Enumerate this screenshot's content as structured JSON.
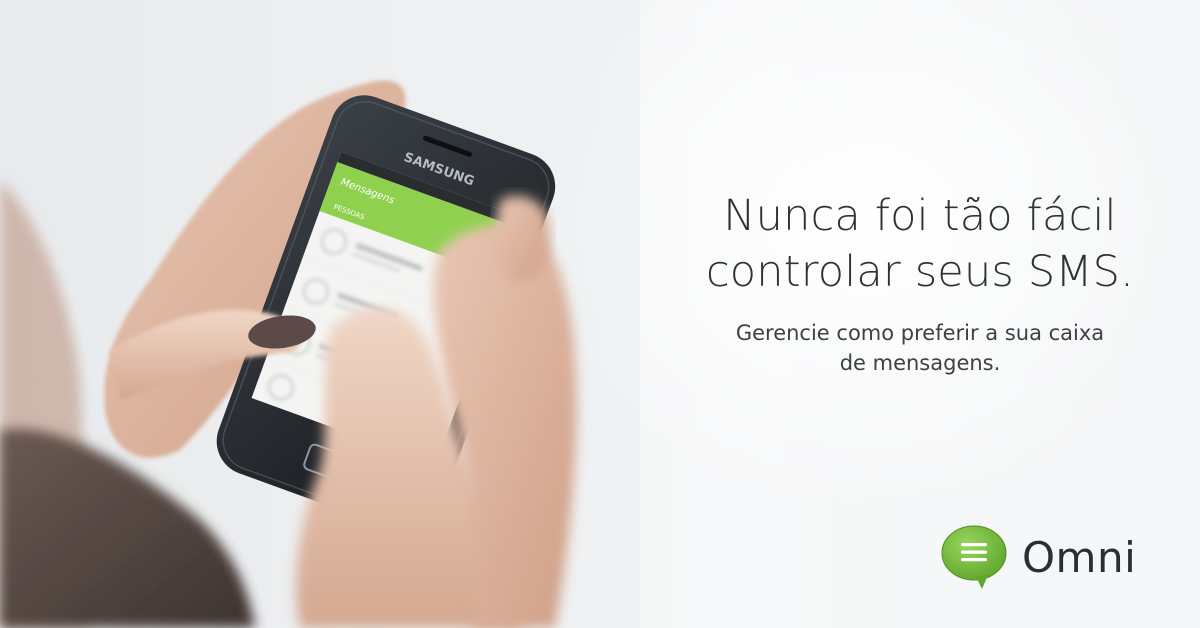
{
  "headline": {
    "line1": "Nunca foi tão fácil",
    "line2": "controlar seus SMS."
  },
  "subheadline": {
    "line1": "Gerencie como preferir a sua caixa",
    "line2": "de mensagens."
  },
  "brand": {
    "name": "Omni",
    "logo_color": "#7bc043"
  },
  "phone": {
    "maker": "SAMSUNG",
    "app_title": "Mensagens",
    "tab_people": "PESSOAS",
    "accent_color": "#8fd14f"
  },
  "icons": [
    "omni-chat-bubble-icon",
    "contact-avatar-icon"
  ]
}
